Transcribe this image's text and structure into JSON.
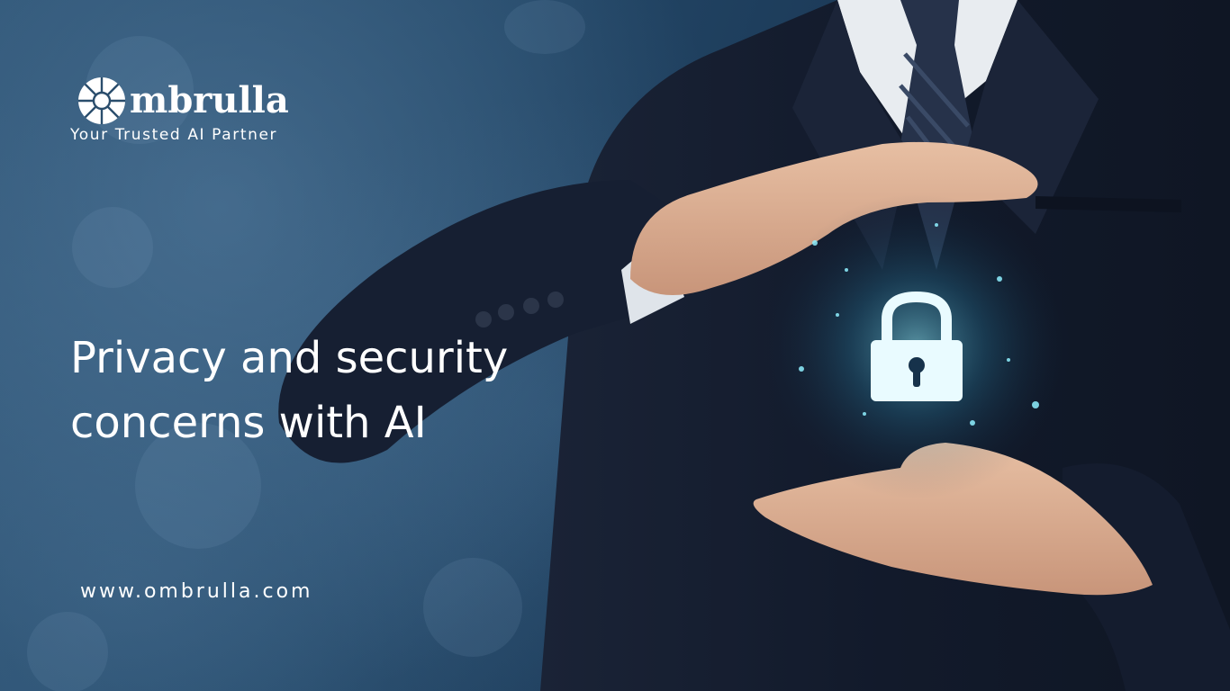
{
  "brand": {
    "name": "mbrulla",
    "tagline": "Your Trusted AI Partner",
    "logo_icon": "umbrella-flower-icon"
  },
  "headline": {
    "line1": "Privacy and security",
    "line2": "concerns with AI"
  },
  "footer": {
    "website": "www.ombrulla.com"
  },
  "colors": {
    "background": "#1d3a55",
    "suit": "#141c2e",
    "text": "#ffffff",
    "lock_glow": "#7fe6ff"
  },
  "icons": {
    "lock": "padlock-icon"
  }
}
